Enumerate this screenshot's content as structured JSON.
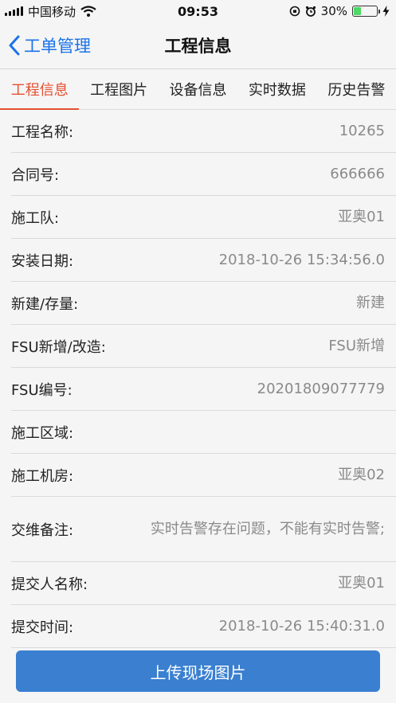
{
  "status_bar": {
    "carrier": "中国移动",
    "time": "09:53",
    "battery_percent": "30%",
    "battery_level": 0.3,
    "icons": [
      "signal-icon",
      "wifi-icon",
      "rotation-lock-icon",
      "alarm-icon",
      "battery-icon",
      "charging-icon"
    ]
  },
  "nav": {
    "back_label": "工单管理",
    "title": "工程信息"
  },
  "tabs": [
    {
      "label": "工程信息",
      "active": true
    },
    {
      "label": "工程图片",
      "active": false
    },
    {
      "label": "设备信息",
      "active": false
    },
    {
      "label": "实时数据",
      "active": false
    },
    {
      "label": "历史告警",
      "active": false
    }
  ],
  "fields": [
    {
      "label": "工程名称:",
      "value": "10265"
    },
    {
      "label": "合同号:",
      "value": "666666"
    },
    {
      "label": "施工队:",
      "value": "亚奥01"
    },
    {
      "label": "安装日期:",
      "value": "2018-10-26 15:34:56.0"
    },
    {
      "label": "新建/存量:",
      "value": "新建"
    },
    {
      "label": "FSU新增/改造:",
      "value": "FSU新增"
    },
    {
      "label": "FSU编号:",
      "value": "20201809077779"
    },
    {
      "label": "施工区域:",
      "value": ""
    },
    {
      "label": "施工机房:",
      "value": "亚奥02"
    },
    {
      "label": "交维备注:",
      "value": "实时告警存在问题，不能有实时告警;"
    },
    {
      "label": "提交人名称:",
      "value": "亚奥01"
    },
    {
      "label": "提交时间:",
      "value": "2018-10-26 15:40:31.0"
    }
  ],
  "upload_button_label": "上传现场图片",
  "colors": {
    "accent_blue": "#1a73e8",
    "active_tab": "#e45030",
    "button_blue": "#3a7fd0",
    "battery_green": "#4cd964"
  }
}
